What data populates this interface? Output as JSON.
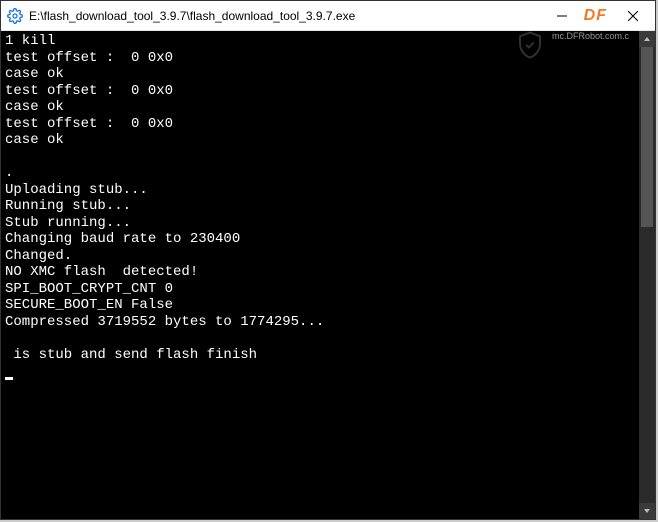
{
  "window": {
    "title": "E:\\flash_download_tool_3.9.7\\flash_download_tool_3.9.7.exe"
  },
  "watermark": {
    "brand": "DF",
    "sub": "mc.DFRobot.com.c"
  },
  "console_lines": [
    "1 kill",
    "test offset :  0 0x0",
    "case ok",
    "test offset :  0 0x0",
    "case ok",
    "test offset :  0 0x0",
    "case ok",
    "",
    ".",
    "Uploading stub...",
    "Running stub...",
    "Stub running...",
    "Changing baud rate to 230400",
    "Changed.",
    "NO XMC flash  detected!",
    "SPI_BOOT_CRYPT_CNT 0",
    "SECURE_BOOT_EN False",
    "Compressed 3719552 bytes to 1774295...",
    "",
    " is stub and send flash finish"
  ]
}
